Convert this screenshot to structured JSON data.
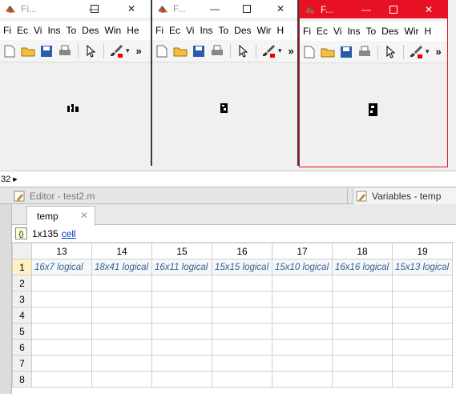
{
  "figures": [
    {
      "title": "Fi...",
      "active": false
    },
    {
      "title": "F...",
      "active": false
    },
    {
      "title": "F...",
      "active": true
    }
  ],
  "figure_menu": [
    "Fi",
    "Ec",
    "Vi",
    "Ins",
    "To",
    "Des",
    "Win",
    "He"
  ],
  "figure_menu_w2": [
    "Fi",
    "Ec",
    "Vi",
    "Ins",
    "To",
    "Des",
    "Wir",
    "H"
  ],
  "status": {
    "text": "32 ▸"
  },
  "doc_tabs": {
    "editor": "Editor - test2.m",
    "variables": "Variables - temp"
  },
  "variable_tab": {
    "name": "temp",
    "close": "✕"
  },
  "variable_info": {
    "size": "1x135",
    "type": "cell"
  },
  "grid": {
    "columns": [
      "13",
      "14",
      "15",
      "16",
      "17",
      "18",
      "19"
    ],
    "rows": [
      "1",
      "2",
      "3",
      "4",
      "5",
      "6",
      "7",
      "8"
    ],
    "row1": [
      "16x7 logical",
      "18x41 logical",
      "16x11 logical",
      "15x15 logical",
      "15x10 logical",
      "16x16 logical",
      "15x13 logical"
    ]
  },
  "colors": {
    "active_title": "#e81123",
    "cell_text": "#35608e",
    "link": "#0033cc"
  }
}
